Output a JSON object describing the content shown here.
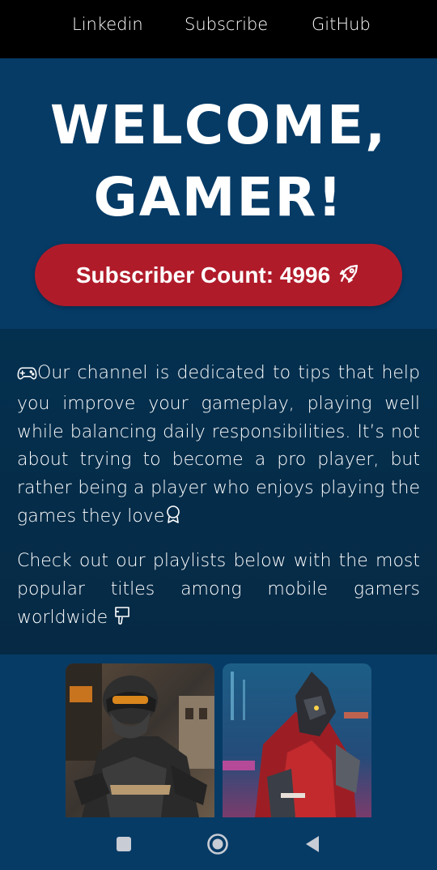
{
  "topnav": {
    "links": [
      "Linkedin",
      "Subscribe",
      "GitHub"
    ]
  },
  "hero": {
    "title_line1": "WELCOME,",
    "title_line2": "GAMER!",
    "cta_label": "Subscriber Count: 4996",
    "cta_icon": "rocket-icon"
  },
  "about": {
    "paragraph1": "Our channel is dedicated to tips that help you improve your gameplay, playing well while balancing daily responsibilities. It’s not about trying to become a pro player, but rather being a player who enjoys playing the games they love",
    "paragraph2": "Check out our playlists below with the most popular titles among mobile gamers worldwide"
  },
  "playlists": {
    "cards": [
      "soldier-game-thumbnail",
      "hooded-warrior-game-thumbnail"
    ]
  },
  "system_nav": {
    "buttons": [
      "recent-apps-icon",
      "home-icon",
      "back-icon"
    ]
  },
  "colors": {
    "nav_bg": "#000000",
    "page_bg": "#063b66",
    "section_bg": "#04304f",
    "cta_bg": "#b01b2a",
    "text": "#ffffff"
  }
}
